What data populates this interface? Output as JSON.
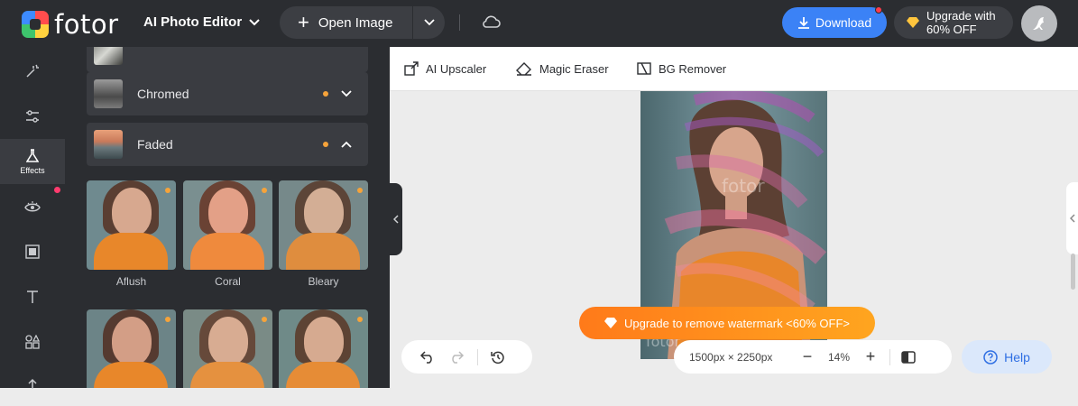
{
  "app": {
    "logo_text": "fotor",
    "editor_menu": "AI Photo Editor",
    "open_image": "Open Image",
    "download": "Download",
    "upgrade_line1": "Upgrade with",
    "upgrade_line2": "60% OFF"
  },
  "sidebar": {
    "active_label": "Effects",
    "items": [
      "magic-wand-icon",
      "sliders-icon",
      "flask-icon",
      "eye-icon",
      "frame-icon",
      "text-icon",
      "shapes-icon",
      "upload-icon"
    ]
  },
  "effects": {
    "groups": [
      {
        "name": "Chromed",
        "expanded": false
      },
      {
        "name": "Faded",
        "expanded": true
      }
    ],
    "faded_filters": [
      "Aflush",
      "Coral",
      "Bleary"
    ]
  },
  "tools": {
    "upscaler": "AI Upscaler",
    "eraser": "Magic Eraser",
    "bg_remover": "BG Remover"
  },
  "canvas": {
    "watermark_text": "fotor",
    "banner": "Upgrade to remove watermark <60% OFF>"
  },
  "bottom": {
    "dimensions": "1500px × 2250px",
    "zoom": "14%",
    "help": "Help"
  },
  "colors": {
    "accent_blue": "#3b82f6",
    "accent_orange": "#ff8a1f",
    "dark_bg": "#2b2d31"
  }
}
